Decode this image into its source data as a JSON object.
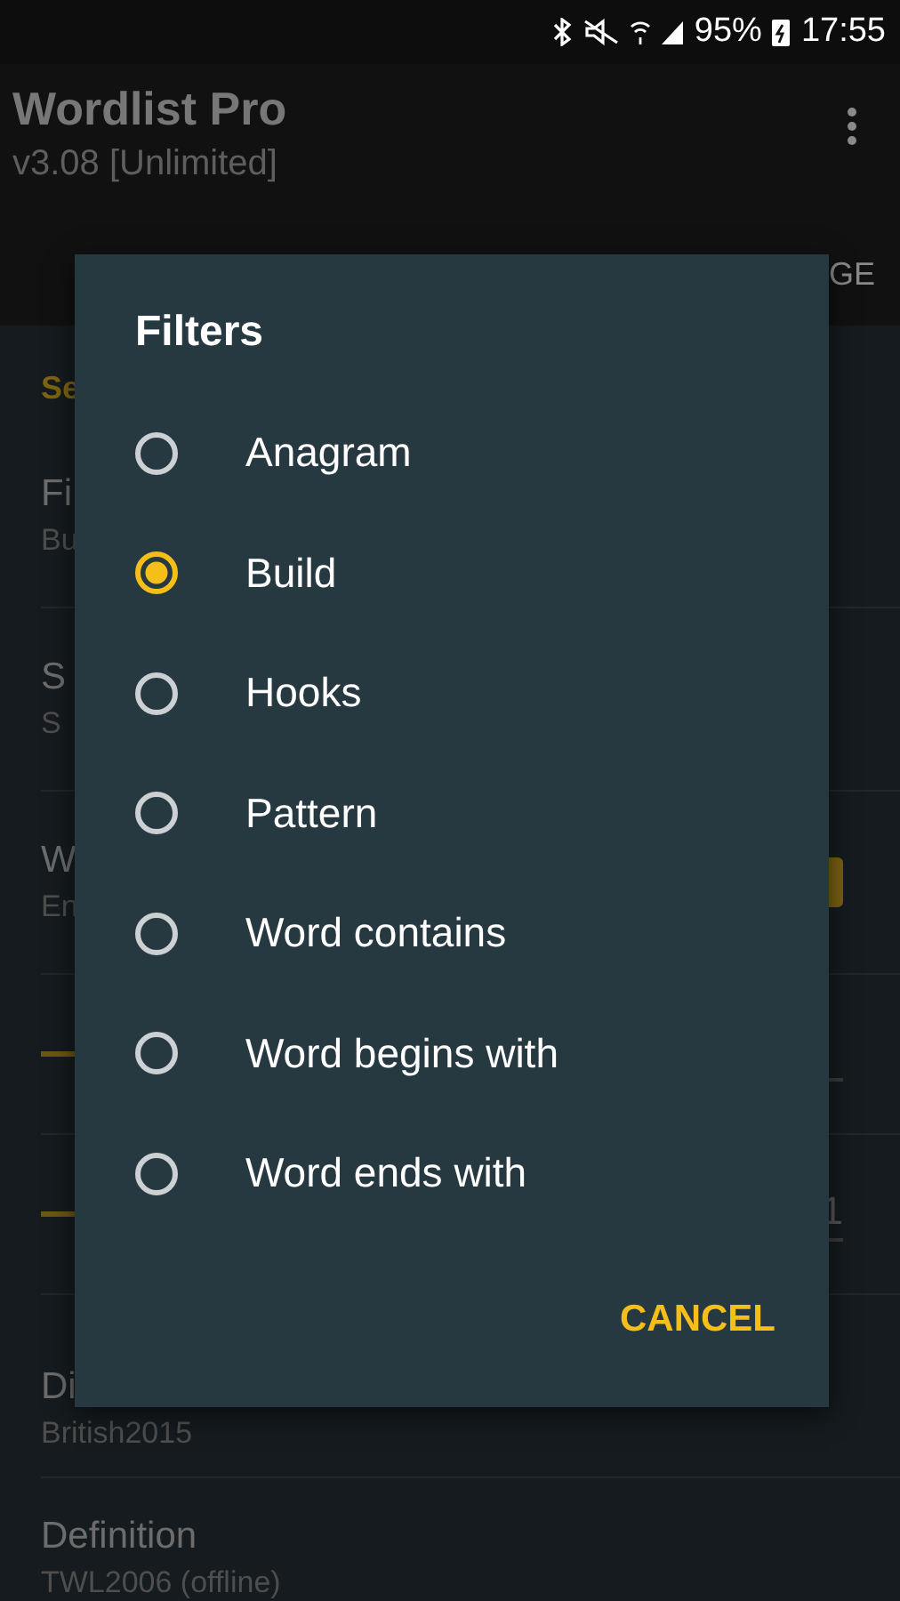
{
  "status_bar": {
    "battery": "95%",
    "time": "17:55"
  },
  "app_bar": {
    "title": "Wordlist Pro",
    "subtitle": "v3.08 [Unlimited]"
  },
  "tab_fragment": "GE",
  "section_header": "Se",
  "settings": [
    {
      "kind": "text",
      "title": "Fi",
      "subtitle": "Bu"
    },
    {
      "kind": "text",
      "title": "S",
      "subtitle": "S"
    },
    {
      "kind": "checkbox",
      "title": "W",
      "subtitle": "En",
      "checked": true
    },
    {
      "kind": "slider"
    },
    {
      "kind": "slider",
      "value": "1"
    },
    {
      "kind": "text",
      "title": "Di",
      "subtitle": "British2015"
    },
    {
      "kind": "text",
      "title": "Definition",
      "subtitle": "TWL2006 (offline)"
    }
  ],
  "dialog": {
    "title": "Filters",
    "options": [
      {
        "label": "Anagram",
        "selected": false
      },
      {
        "label": "Build",
        "selected": true
      },
      {
        "label": "Hooks",
        "selected": false
      },
      {
        "label": "Pattern",
        "selected": false
      },
      {
        "label": "Word contains",
        "selected": false
      },
      {
        "label": "Word begins with",
        "selected": false
      },
      {
        "label": "Word ends with",
        "selected": false
      }
    ],
    "button": "CANCEL"
  }
}
